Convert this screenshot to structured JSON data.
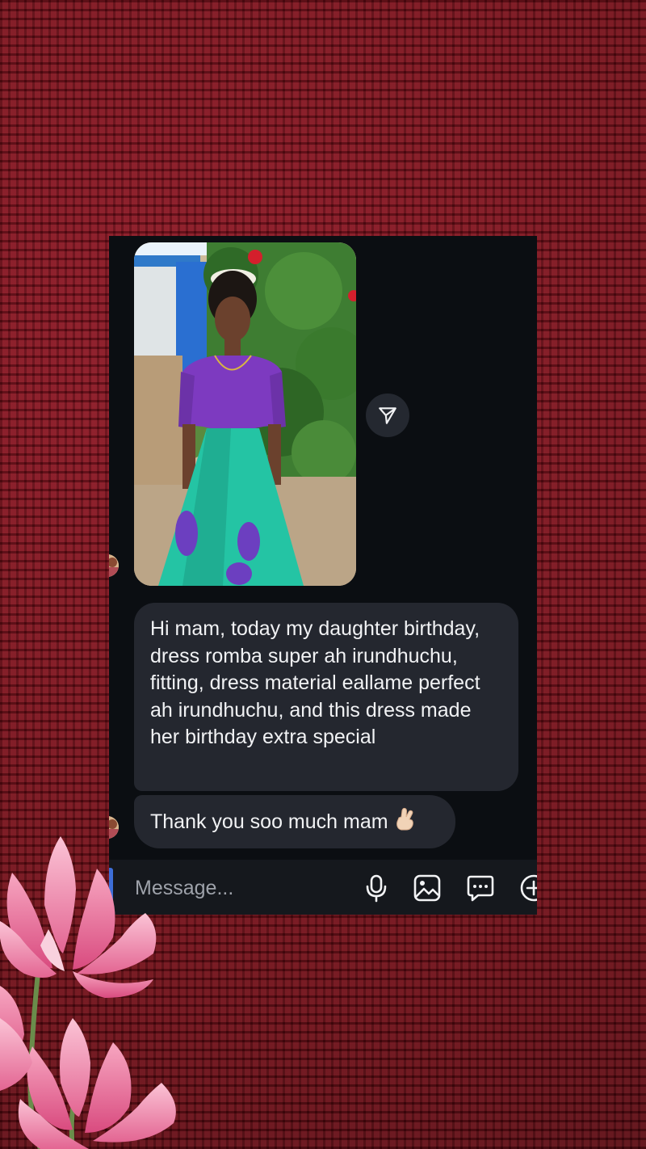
{
  "conversation": {
    "messages": [
      {
        "type": "photo"
      },
      {
        "type": "text",
        "text": "Hi mam, today my daughter birthday, dress romba super ah irundhuchu, fitting, dress material eallame perfect ah irundhuchu, and this dress made her birthday extra special"
      },
      {
        "type": "text",
        "text": "Thank you soo much mam",
        "emoji": "crossed-fingers-icon"
      }
    ]
  },
  "composer": {
    "placeholder": "Message...",
    "icons": [
      "microphone-icon",
      "gallery-icon",
      "sticker-icon",
      "plus-icon"
    ]
  },
  "colors": {
    "background": "#7a0d17",
    "chat_background": "#0b0e12",
    "bubble": "#24272f",
    "text": "#f1f2f4",
    "placeholder": "#9ea2aa"
  }
}
